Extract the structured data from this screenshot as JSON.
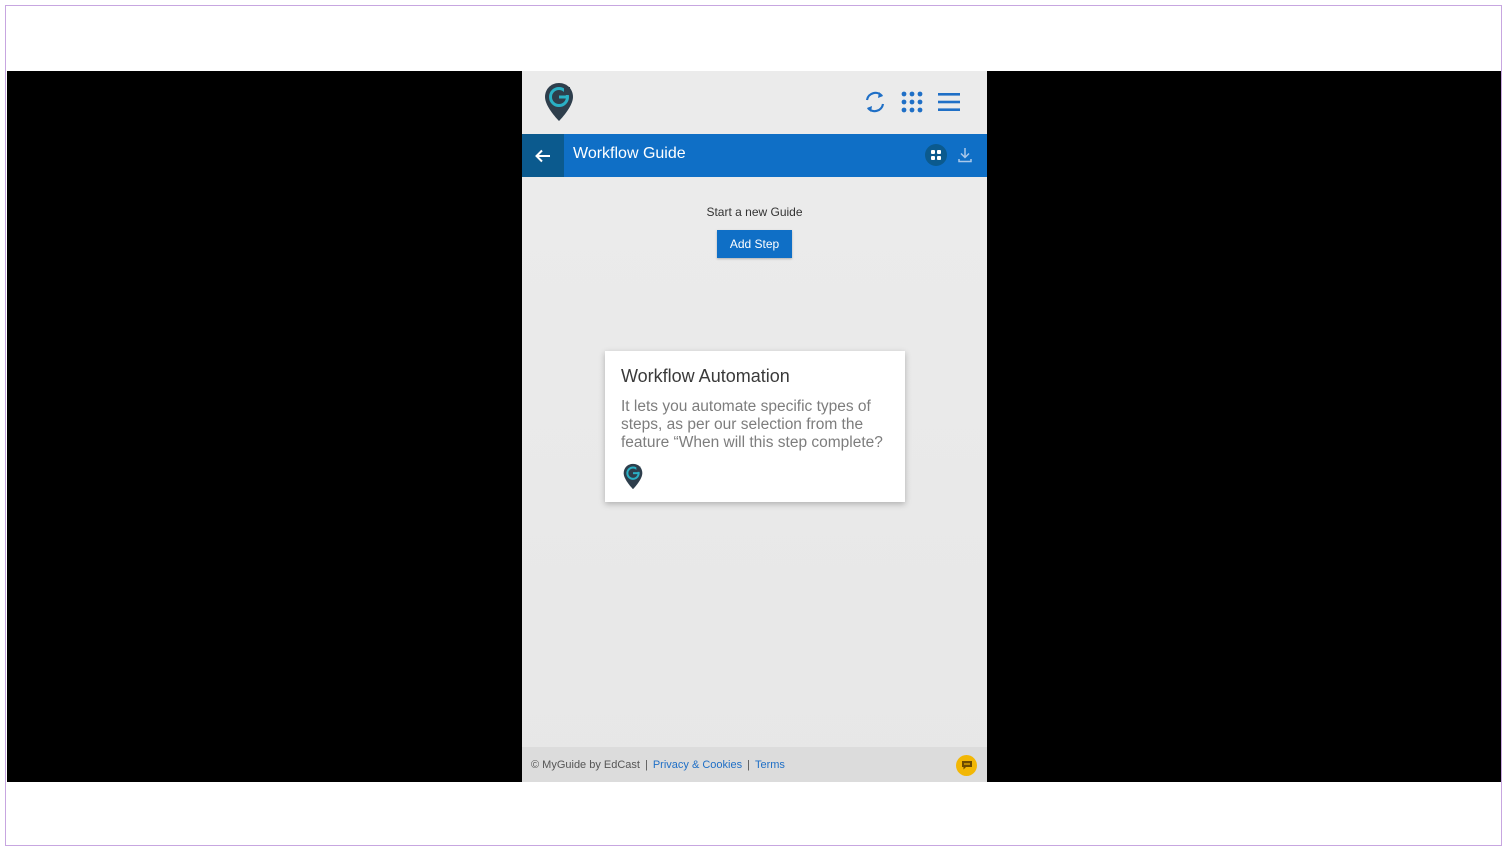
{
  "header": {
    "logo_icon": "myguide-pin-logo-icon",
    "refresh_icon": "refresh-icon",
    "apps_icon": "apps-grid-icon",
    "menu_icon": "hamburger-menu-icon"
  },
  "titlebar": {
    "title": "Workflow Guide",
    "back_icon": "arrow-left-icon",
    "grid_icon": "grid-view-icon",
    "download_icon": "download-icon"
  },
  "main": {
    "start_label": "Start a new Guide",
    "add_step_label": "Add Step"
  },
  "card": {
    "title": "Workflow Automation",
    "text": "It lets you automate specific types of steps, as per our selection from the feature “When will this step complete?"
  },
  "footer": {
    "copyright": "© MyGuide by EdCast",
    "privacy_link": "Privacy & Cookies",
    "terms_link": "Terms",
    "chat_icon": "chat-bubble-icon"
  },
  "colors": {
    "primary_blue": "#0f6fc6",
    "dark_blue": "#0b5a8e",
    "chat_yellow": "#f2b705",
    "logo_dark": "#2e3e4c",
    "logo_teal": "#2ab0c5"
  }
}
